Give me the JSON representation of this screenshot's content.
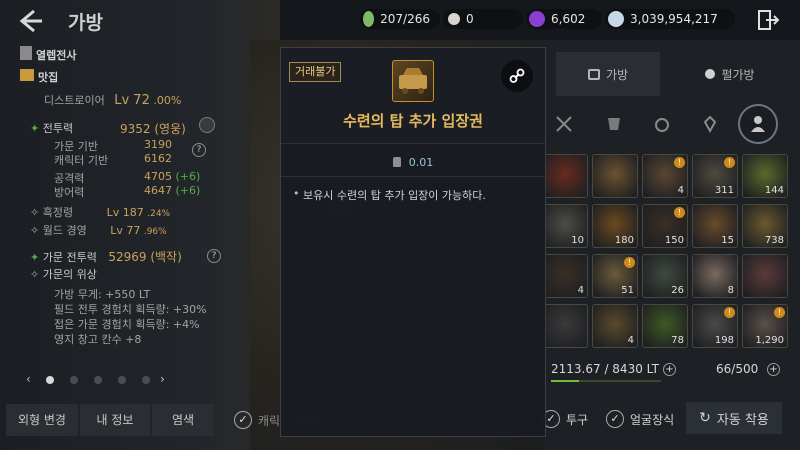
{
  "header": {
    "title": "가방",
    "currencies": [
      {
        "icon": "energy-icon",
        "value": "207/266",
        "color": "#7fb96a"
      },
      {
        "icon": "pearl-icon",
        "value": "0",
        "color": "#d9d4cf"
      },
      {
        "icon": "black-gem-icon",
        "value": "6,602",
        "color": "#8a3fd0"
      },
      {
        "icon": "silver-icon",
        "value": "3,039,954,217",
        "color": "#c7d7e6"
      }
    ]
  },
  "character": {
    "family_name": "열렙전사",
    "name": "맛집",
    "class": "디스트로이어",
    "level_label": "Lv 72",
    "level_percent": ".00%",
    "combat_power_label": "전투력",
    "combat_power": "9352 (영웅)",
    "family_base_label": "가문 기반",
    "family_base": "3190",
    "char_base_label": "캐릭터 기반",
    "char_base": "6162",
    "attack_label": "공격력",
    "attack": "4705",
    "attack_bonus": "(+6)",
    "defense_label": "방어력",
    "defense": "4647",
    "defense_bonus": "(+6)",
    "skill_label": "흑정령",
    "skill_level": "Lv 187",
    "skill_percent": ".24%",
    "world_label": "월드 경영",
    "world_level": "Lv 77",
    "world_percent": ".96%",
    "family_cp_label": "가문 전투력",
    "family_cp": "52969 (백작)",
    "family_title_label": "가문의 위상",
    "family_stats": [
      "가방 무게: +550 LT",
      "필드 전투 경험치 획득량: +30%",
      "접은 가문 경험치 획득량: +4%",
      "영지 창고 칸수 +8"
    ]
  },
  "left_buttons": [
    "외형 변경",
    "내 정보",
    "염색"
  ],
  "character_toggle": "캐릭터 회전",
  "pager": {
    "count": 5,
    "active": 0
  },
  "right_tabs": [
    "가방",
    "펄가방"
  ],
  "inventory": {
    "weight": "2113.67 / 8430 LT",
    "weight_fraction": 0.25,
    "capacity": "66/500",
    "slots": [
      {
        "count": "",
        "badge": false,
        "color": "#6a2a1e"
      },
      {
        "count": "",
        "badge": false,
        "color": "#6b5331"
      },
      {
        "count": "4",
        "badge": true,
        "color": "#5a4634"
      },
      {
        "count": "311",
        "badge": true,
        "color": "#4f4a3e"
      },
      {
        "count": "144",
        "badge": false,
        "color": "#5b6a2a"
      },
      {
        "count": "10",
        "badge": false,
        "color": "#4e4c44"
      },
      {
        "count": "180",
        "badge": false,
        "color": "#6b4a1e"
      },
      {
        "count": "150",
        "badge": true,
        "color": "#3a2e24"
      },
      {
        "count": "15",
        "badge": false,
        "color": "#6a4a2a"
      },
      {
        "count": "738",
        "badge": false,
        "color": "#6a5a2e"
      },
      {
        "count": "4",
        "badge": false,
        "color": "#3a2e24"
      },
      {
        "count": "51",
        "badge": true,
        "color": "#6b5a3a"
      },
      {
        "count": "26",
        "badge": false,
        "color": "#3f4a3e"
      },
      {
        "count": "8",
        "badge": false,
        "color": "#7a6a5e"
      },
      {
        "count": "",
        "badge": false,
        "color": "#5e3a3a"
      },
      {
        "count": "",
        "badge": false,
        "color": "#3a3a3a"
      },
      {
        "count": "4",
        "badge": false,
        "color": "#5b4a2a"
      },
      {
        "count": "78",
        "badge": false,
        "color": "#3e5a24"
      },
      {
        "count": "198",
        "badge": true,
        "color": "#4a4a4a"
      },
      {
        "count": "1,290",
        "badge": true,
        "color": "#5b5048"
      }
    ]
  },
  "bottom_right": {
    "cloth_label": "투구",
    "face_label": "얼굴장식",
    "auto_equip_label": "자동 착용"
  },
  "tooltip": {
    "tag": "거래불가",
    "item_name": "수련의 탑 추가 입장권",
    "weight": "0.01",
    "description": "보유시 수련의 탑 추가 입장이 가능하다."
  }
}
